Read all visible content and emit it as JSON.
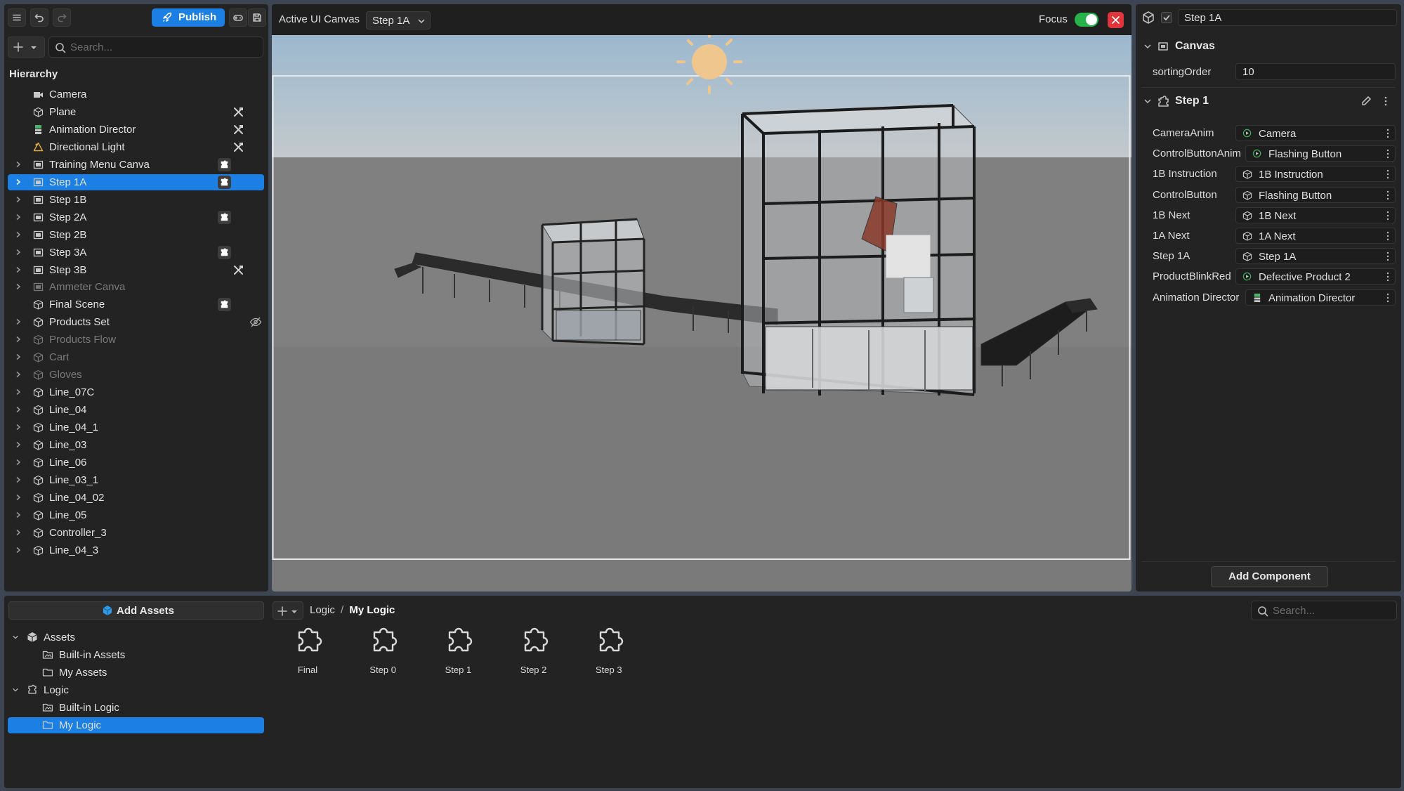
{
  "toolbar": {
    "publish_label": "Publish",
    "search_placeholder": "Search..."
  },
  "hierarchy": {
    "title": "Hierarchy",
    "items": [
      {
        "label": "Camera",
        "icon": "camera-icon",
        "expandable": false,
        "dim": false,
        "selected": false,
        "badge": "",
        "right": ""
      },
      {
        "label": "Plane",
        "icon": "cube-icon",
        "expandable": false,
        "dim": false,
        "selected": false,
        "badge": "",
        "right": "x"
      },
      {
        "label": "Animation Director",
        "icon": "animation-director-icon",
        "expandable": false,
        "dim": false,
        "selected": false,
        "badge": "",
        "right": "x"
      },
      {
        "label": "Directional Light",
        "icon": "light-icon",
        "expandable": false,
        "dim": false,
        "selected": false,
        "badge": "",
        "right": "x"
      },
      {
        "label": "Training Menu Canva",
        "icon": "canvas-icon",
        "expandable": true,
        "dim": false,
        "selected": false,
        "badge": "logic",
        "right": ""
      },
      {
        "label": "Step 1A",
        "icon": "canvas-icon",
        "expandable": true,
        "dim": false,
        "selected": true,
        "badge": "logic",
        "right": ""
      },
      {
        "label": "Step 1B",
        "icon": "canvas-icon",
        "expandable": true,
        "dim": false,
        "selected": false,
        "badge": "",
        "right": ""
      },
      {
        "label": "Step 2A",
        "icon": "canvas-icon",
        "expandable": true,
        "dim": false,
        "selected": false,
        "badge": "logic",
        "right": ""
      },
      {
        "label": "Step 2B",
        "icon": "canvas-icon",
        "expandable": true,
        "dim": false,
        "selected": false,
        "badge": "",
        "right": ""
      },
      {
        "label": "Step 3A",
        "icon": "canvas-icon",
        "expandable": true,
        "dim": false,
        "selected": false,
        "badge": "logic",
        "right": ""
      },
      {
        "label": "Step 3B",
        "icon": "canvas-icon",
        "expandable": true,
        "dim": false,
        "selected": false,
        "badge": "",
        "right": "x"
      },
      {
        "label": "Ammeter Canva",
        "icon": "canvas-icon",
        "expandable": true,
        "dim": true,
        "selected": false,
        "badge": "",
        "right": ""
      },
      {
        "label": "Final Scene",
        "icon": "cube-icon",
        "expandable": false,
        "dim": false,
        "selected": false,
        "badge": "logic",
        "right": ""
      },
      {
        "label": "Products Set",
        "icon": "cube-icon",
        "expandable": true,
        "dim": false,
        "selected": false,
        "badge": "",
        "right": "hide"
      },
      {
        "label": "Products Flow",
        "icon": "cube-icon",
        "expandable": true,
        "dim": true,
        "selected": false,
        "badge": "",
        "right": ""
      },
      {
        "label": "Cart",
        "icon": "cube-icon",
        "expandable": true,
        "dim": true,
        "selected": false,
        "badge": "",
        "right": ""
      },
      {
        "label": "Gloves",
        "icon": "cube-icon",
        "expandable": true,
        "dim": true,
        "selected": false,
        "badge": "",
        "right": ""
      },
      {
        "label": "Line_07C",
        "icon": "cube-icon",
        "expandable": true,
        "dim": false,
        "selected": false,
        "badge": "",
        "right": ""
      },
      {
        "label": "Line_04",
        "icon": "cube-icon",
        "expandable": true,
        "dim": false,
        "selected": false,
        "badge": "",
        "right": ""
      },
      {
        "label": "Line_04_1",
        "icon": "cube-icon",
        "expandable": true,
        "dim": false,
        "selected": false,
        "badge": "",
        "right": ""
      },
      {
        "label": "Line_03",
        "icon": "cube-icon",
        "expandable": true,
        "dim": false,
        "selected": false,
        "badge": "",
        "right": ""
      },
      {
        "label": "Line_06",
        "icon": "cube-icon",
        "expandable": true,
        "dim": false,
        "selected": false,
        "badge": "",
        "right": ""
      },
      {
        "label": "Line_03_1",
        "icon": "cube-icon",
        "expandable": true,
        "dim": false,
        "selected": false,
        "badge": "",
        "right": ""
      },
      {
        "label": "Line_04_02",
        "icon": "cube-icon",
        "expandable": true,
        "dim": false,
        "selected": false,
        "badge": "",
        "right": ""
      },
      {
        "label": "Line_05",
        "icon": "cube-icon",
        "expandable": true,
        "dim": false,
        "selected": false,
        "badge": "",
        "right": ""
      },
      {
        "label": "Controller_3",
        "icon": "cube-icon",
        "expandable": true,
        "dim": false,
        "selected": false,
        "badge": "",
        "right": ""
      },
      {
        "label": "Line_04_3",
        "icon": "cube-icon",
        "expandable": true,
        "dim": false,
        "selected": false,
        "badge": "",
        "right": ""
      }
    ]
  },
  "viewport": {
    "canvas_label": "Active UI Canvas",
    "canvas_selected": "Step 1A",
    "focus_label": "Focus",
    "focus_on": true
  },
  "inspector": {
    "object_name": "Step 1A",
    "canvas_section": "Canvas",
    "sorting_order_label": "sortingOrder",
    "sorting_order_value": "10",
    "step_section": "Step 1",
    "props": [
      {
        "label": "CameraAnim",
        "value": "Camera",
        "icon": "play-circle-icon"
      },
      {
        "label": "ControlButtonAnim",
        "value": "Flashing Button",
        "icon": "play-circle-icon"
      },
      {
        "label": "1B Instruction",
        "value": "1B Instruction",
        "icon": "cube-icon"
      },
      {
        "label": "ControlButton",
        "value": "Flashing Button",
        "icon": "cube-icon"
      },
      {
        "label": "1B Next",
        "value": "1B Next",
        "icon": "cube-icon"
      },
      {
        "label": "1A Next",
        "value": "1A Next",
        "icon": "cube-icon"
      },
      {
        "label": "Step 1A",
        "value": "Step 1A",
        "icon": "cube-icon"
      },
      {
        "label": "ProductBlinkRed",
        "value": "Defective Product 2",
        "icon": "play-circle-icon"
      },
      {
        "label": "Animation Director",
        "value": "Animation Director",
        "icon": "animation-director-icon"
      }
    ],
    "add_component_label": "Add Component"
  },
  "assets": {
    "add_assets_label": "Add Assets",
    "tree": [
      {
        "label": "Assets",
        "level": 0,
        "icon": "package-icon",
        "expanded": true,
        "selected": false
      },
      {
        "label": "Built-in Assets",
        "level": 1,
        "icon": "folder-image-icon",
        "expanded": false,
        "selected": false
      },
      {
        "label": "My Assets",
        "level": 1,
        "icon": "folder-icon",
        "expanded": false,
        "selected": false
      },
      {
        "label": "Logic",
        "level": 0,
        "icon": "logic-icon",
        "expanded": true,
        "selected": false
      },
      {
        "label": "Built-in Logic",
        "level": 1,
        "icon": "folder-image-icon",
        "expanded": false,
        "selected": false
      },
      {
        "label": "My Logic",
        "level": 1,
        "icon": "folder-icon",
        "expanded": false,
        "selected": true
      }
    ],
    "breadcrumb": {
      "root": "Logic",
      "separator": "/",
      "current": "My Logic"
    },
    "search_placeholder": "Search...",
    "items": [
      "Final",
      "Step 0",
      "Step 1",
      "Step 2",
      "Step 3"
    ]
  },
  "colors": {
    "accent": "#1b7fe3",
    "toggle_on": "#27b24a",
    "close_red": "#e2343b"
  }
}
